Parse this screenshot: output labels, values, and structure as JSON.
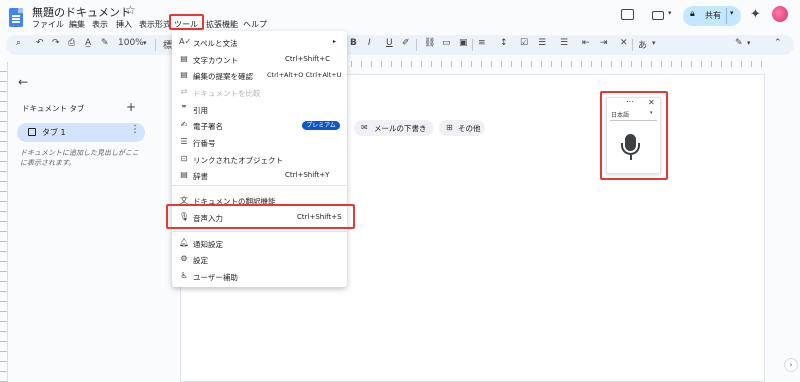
{
  "title_bar": {
    "doc_title": "無題のドキュメント",
    "star_icon": "☆"
  },
  "menu": [
    {
      "label": "ファイル"
    },
    {
      "label": "編集"
    },
    {
      "label": "表示"
    },
    {
      "label": "挿入"
    },
    {
      "label": "表示形式"
    },
    {
      "label": "ツール"
    },
    {
      "label": "拡張機能"
    },
    {
      "label": "ヘルプ"
    }
  ],
  "header_right": {
    "share_label": "共有"
  },
  "toolbar": {
    "zoom": "100%",
    "style_partial": "標",
    "bold": "B",
    "italic": "I",
    "underline": "U",
    "text_case": "あ"
  },
  "sidebar": {
    "doc_tabs_title": "ドキュメント タブ",
    "tab1_label": "タブ 1",
    "outline_hint": "ドキュメントに追加した見出しがここに表示されます。"
  },
  "page_chips": [
    {
      "label": "メールの下書き"
    },
    {
      "label": "その他"
    }
  ],
  "tools_menu": {
    "items": [
      {
        "label": "スペルと文法",
        "shortcut": "▸"
      },
      {
        "label": "文字カウント",
        "shortcut": "Ctrl+Shift+C"
      },
      {
        "label": "編集の提案を確認",
        "shortcut": "Ctrl+Alt+O Ctrl+Alt+U"
      },
      {
        "label": "ドキュメントを比較",
        "shortcut": ""
      },
      {
        "label": "引用",
        "shortcut": ""
      },
      {
        "label": "電子署名",
        "shortcut": ""
      },
      {
        "label": "行番号",
        "shortcut": ""
      },
      {
        "label": "リンクされたオブジェクト",
        "shortcut": ""
      },
      {
        "label": "辞書",
        "shortcut": "Ctrl+Shift+Y"
      },
      {
        "label": "ドキュメントの翻訳機能",
        "shortcut": ""
      },
      {
        "label": "音声入力",
        "shortcut": "Ctrl+Shift+S"
      },
      {
        "label": "通知設定",
        "shortcut": ""
      },
      {
        "label": "設定",
        "shortcut": ""
      },
      {
        "label": "ユーザー補助",
        "shortcut": ""
      }
    ],
    "premium_badge": "プレミアム"
  },
  "voice_widget": {
    "language": "日本語"
  },
  "colors": {
    "accent": "#0b57d0",
    "share_bg": "#c2e7ff",
    "highlight": "#e53935",
    "tab_active": "#d3e3fd"
  }
}
